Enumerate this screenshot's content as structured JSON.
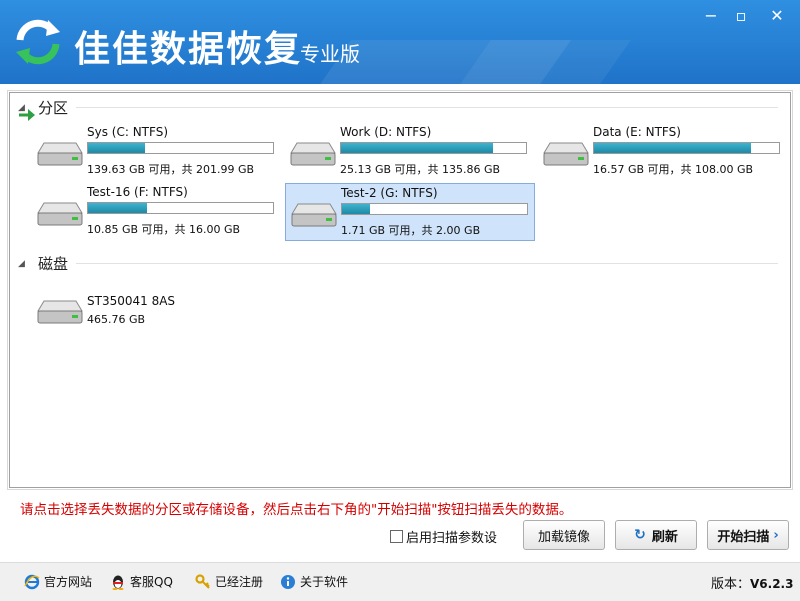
{
  "app": {
    "title": "佳佳数据恢复",
    "edition": "专业版"
  },
  "window": {
    "minimize": "−",
    "maximize": "▫",
    "close": "✕"
  },
  "sections": {
    "partitions": "分区",
    "disks": "磁盘"
  },
  "partitions": [
    {
      "name": "Sys (C: NTFS)",
      "info": "139.63 GB 可用，共 201.99 GB",
      "used_fraction": 0.31
    },
    {
      "name": "Work (D: NTFS)",
      "info": "25.13 GB 可用，共 135.86 GB",
      "used_fraction": 0.82
    },
    {
      "name": "Data (E: NTFS)",
      "info": "16.57 GB 可用，共 108.00 GB",
      "used_fraction": 0.85
    },
    {
      "name": "Test-16 (F: NTFS)",
      "info": "10.85 GB 可用，共 16.00 GB",
      "used_fraction": 0.32
    },
    {
      "name": "Test-2 (G: NTFS)",
      "info": "1.71 GB 可用，共 2.00 GB",
      "used_fraction": 0.15,
      "selected": true
    }
  ],
  "disks": [
    {
      "name": "ST350041 8AS",
      "size": "465.76 GB"
    }
  ],
  "message": "请点击选择丢失数据的分区或存储设备，然后点击右下角的\"开始扫描\"按钮扫描丢失的数据。",
  "actions": {
    "scan_params": "启用扫描参数设",
    "load_image": "加载镜像",
    "refresh": "刷新",
    "start_scan": "开始扫描"
  },
  "footer": {
    "website": "官方网站",
    "support": "客服QQ",
    "registered": "已经注册",
    "about": "关于软件",
    "version_label": "版本：",
    "version": "V6.2.3"
  },
  "colors": {
    "titlebar": "#2378cf",
    "message": "#d40000",
    "bar_fill": "#2a9bb8",
    "selected": "#cfe4fb"
  }
}
